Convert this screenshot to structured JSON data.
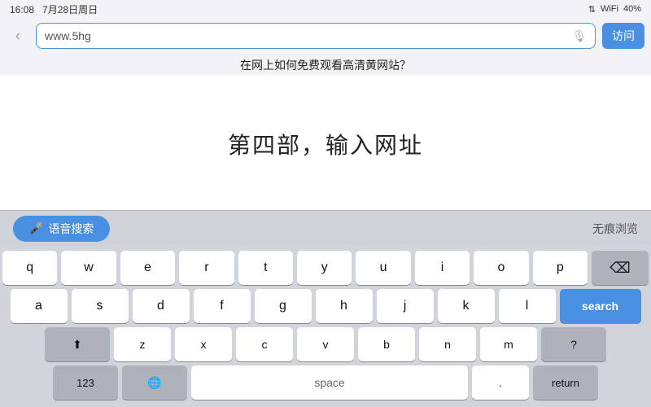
{
  "statusBar": {
    "time": "16:08",
    "date": "7月28日周日",
    "signal": "▲▼",
    "battery": "40%"
  },
  "browserBar": {
    "backLabel": "‹",
    "addressText": "www.5hg",
    "micIcon": "🎙",
    "visitLabel": "访问"
  },
  "pageTitle": "在网上如何免费观看高清黄网站？",
  "mainContent": {
    "text": "第四部，输入网址"
  },
  "keyboard": {
    "toolbar": {
      "voiceSearchLabel": "🎤 语音搜索",
      "rightText": "无痕浏览"
    },
    "rows": [
      [
        "q",
        "w",
        "e",
        "r",
        "t",
        "y",
        "u",
        "i",
        "o",
        "p"
      ],
      [
        "a",
        "s",
        "d",
        "f",
        "g",
        "h",
        "j",
        "k",
        "l"
      ],
      [
        "z",
        "x",
        "c",
        "v",
        "b",
        "n",
        "m"
      ],
      [
        "search"
      ]
    ]
  }
}
